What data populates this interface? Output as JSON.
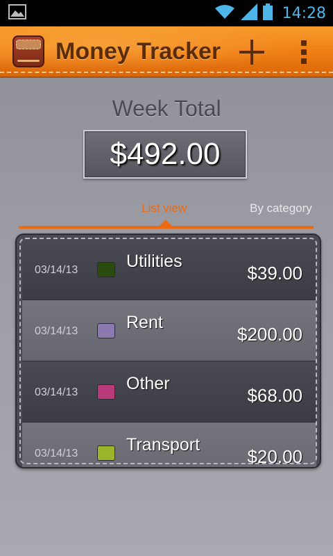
{
  "status_bar": {
    "time": "14:28",
    "icons": [
      "image-icon",
      "wifi-icon",
      "signal-icon",
      "battery-icon"
    ],
    "time_color": "#4db5e8"
  },
  "action_bar": {
    "title": "Money Tracker",
    "icons": [
      "wallet-icon",
      "add-icon",
      "overflow-menu-icon"
    ],
    "accent": "#ee7d14"
  },
  "summary": {
    "label": "Week Total",
    "value": "$492.00"
  },
  "tabs": [
    {
      "label": "List view",
      "selected": true
    },
    {
      "label": "By category",
      "selected": false
    }
  ],
  "accent_color": "#ee6a10",
  "expenses": [
    {
      "date": "03/14/13",
      "category": "Utilities",
      "amount": "$39.00",
      "color": "#2b4a0e"
    },
    {
      "date": "03/14/13",
      "category": "Rent",
      "amount": "$200.00",
      "color": "#8a7ab0"
    },
    {
      "date": "03/14/13",
      "category": "Other",
      "amount": "$68.00",
      "color": "#b83a78"
    },
    {
      "date": "03/14/13",
      "category": "Transport",
      "amount": "$20.00",
      "color": "#9ab52a"
    }
  ]
}
